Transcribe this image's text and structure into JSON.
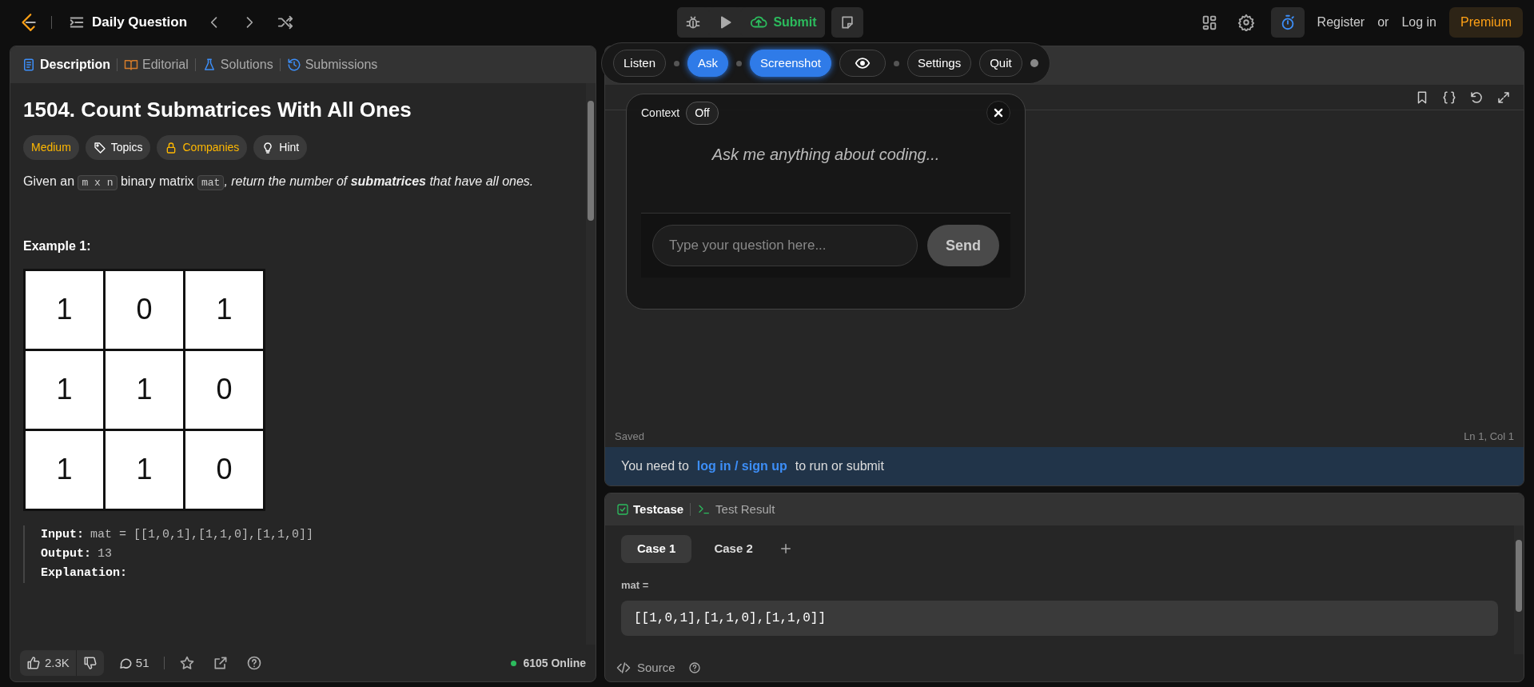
{
  "topbar": {
    "title": "Daily Question",
    "submit": "Submit",
    "register": "Register",
    "or": "or",
    "login": "Log in",
    "premium": "Premium"
  },
  "description_panel": {
    "tabs": [
      {
        "label": "Description",
        "selected": true,
        "kind": "description"
      },
      {
        "label": "Editorial",
        "selected": false,
        "kind": "editorial"
      },
      {
        "label": "Solutions",
        "selected": false,
        "kind": "solutions"
      },
      {
        "label": "Submissions",
        "selected": false,
        "kind": "submissions"
      }
    ],
    "title": "1504. Count Submatrices With All Ones",
    "tags": [
      {
        "label": "Medium",
        "kind": "difficulty"
      },
      {
        "label": "Topics",
        "kind": "topics"
      },
      {
        "label": "Companies",
        "kind": "companies"
      },
      {
        "label": "Hint",
        "kind": "hint"
      }
    ],
    "statement": [
      {
        "text": "Given an ",
        "kind": "plain"
      },
      {
        "text": "m x n",
        "kind": "code"
      },
      {
        "text": " binary matrix ",
        "kind": "plain"
      },
      {
        "text": "mat",
        "kind": "code"
      },
      {
        "text": ", return the number of ",
        "kind": "italic"
      },
      {
        "text": "submatrices",
        "kind": "bolditalic"
      },
      {
        "text": " that have all ones.",
        "kind": "italic"
      }
    ],
    "example_heading": "Example 1:",
    "example_grid": [
      [
        "1",
        "0",
        "1"
      ],
      [
        "1",
        "1",
        "0"
      ],
      [
        "1",
        "1",
        "0"
      ]
    ],
    "example_lines": [
      {
        "label": "Input:",
        "value": "mat = [[1,0,1],[1,1,0],[1,1,0]]"
      },
      {
        "label": "Output:",
        "value": "13"
      },
      {
        "label": "Explanation:"
      }
    ],
    "footer": {
      "likes": "2.3K",
      "comments": "51",
      "online": "6105 Online"
    }
  },
  "editor": {
    "saved": "Saved",
    "cursor": "Ln 1, Col 1"
  },
  "login_bar": {
    "before": "You need to",
    "link": "log in / sign up",
    "after": "to run or submit"
  },
  "test_panel": {
    "tabs": [
      {
        "label": "Testcase",
        "selected": true,
        "kind": "testcase"
      },
      {
        "label": "Test Result",
        "selected": false,
        "kind": "result"
      }
    ],
    "cases": [
      {
        "label": "Case 1",
        "selected": true
      },
      {
        "label": "Case 2",
        "selected": false
      }
    ],
    "param_label": "mat =",
    "param_value": "[[1,0,1],[1,1,0],[1,1,0]]",
    "source": "Source"
  },
  "assistant_toolbar": {
    "buttons": [
      {
        "kind": "text",
        "label": "Listen",
        "selected": false
      },
      {
        "kind": "text",
        "label": "Ask",
        "selected": true
      },
      {
        "kind": "text",
        "label": "Screenshot",
        "selected": true
      },
      {
        "kind": "eye",
        "selected": false
      },
      {
        "kind": "text",
        "label": "Settings",
        "selected": false
      },
      {
        "kind": "text",
        "label": "Quit",
        "selected": false
      }
    ]
  },
  "chat": {
    "context_label": "Context",
    "context_toggle": "Off",
    "prompt": "Ask me anything about coding...",
    "placeholder": "Type your question here...",
    "send": "Send"
  }
}
